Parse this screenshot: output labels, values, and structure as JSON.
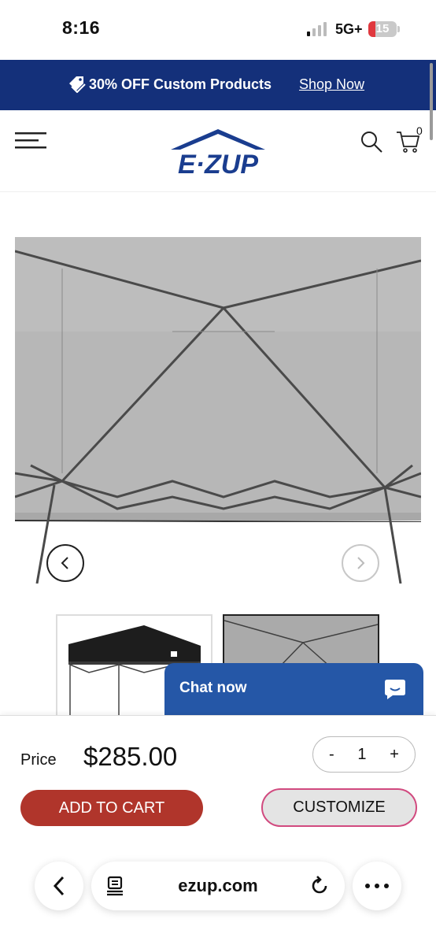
{
  "status_bar": {
    "time": "8:16",
    "network": "5G+",
    "battery": "15"
  },
  "promo": {
    "text": "30% OFF Custom Products",
    "link": "Shop Now"
  },
  "header": {
    "logo_text": "EZUP",
    "cart_count": "0"
  },
  "product": {
    "price_label": "Price",
    "price": "$285.00",
    "quantity": "1",
    "qty_minus": "-",
    "qty_plus": "+",
    "add_to_cart": "ADD TO CART",
    "customize": "CUSTOMIZE"
  },
  "chat": {
    "label": "Chat now"
  },
  "browser": {
    "url": "ezup.com"
  },
  "colors": {
    "promo_bg": "#14307a",
    "brand_blue": "#1a3d8f",
    "add_to_cart": "#b0352b",
    "chat": "#2557a7",
    "customize_border": "#d14a7f"
  },
  "icons": [
    "tag-icon",
    "menu-icon",
    "search-icon",
    "cart-icon",
    "chevron-left-icon",
    "chevron-right-icon",
    "chat-bubble-icon",
    "back-icon",
    "reader-icon",
    "reload-icon",
    "more-icon"
  ]
}
